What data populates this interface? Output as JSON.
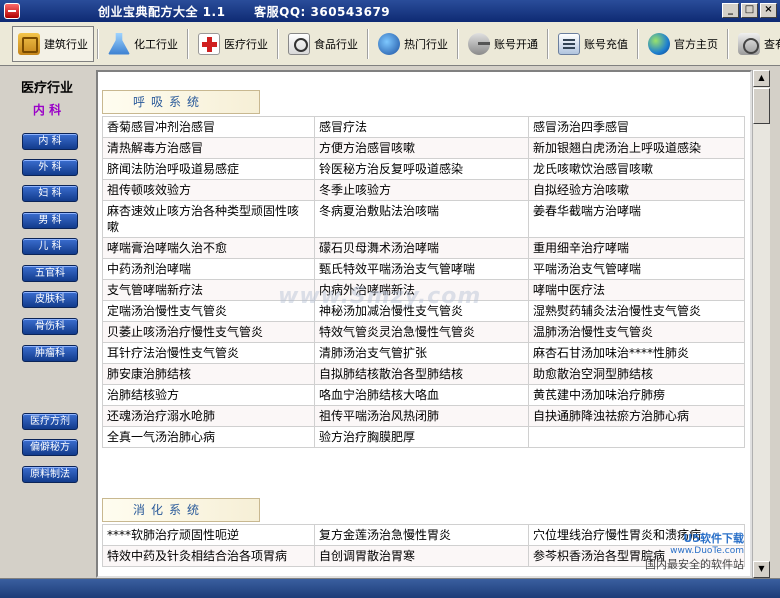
{
  "window": {
    "title": "创业宝典配方大全 1.1",
    "service": "客服QQ: 360543679",
    "controls": [
      "_",
      "□",
      "×"
    ]
  },
  "toolbar": [
    {
      "label": "建筑行业",
      "icon": "building-icon"
    },
    {
      "label": "化工行业",
      "icon": "flask-icon"
    },
    {
      "label": "医疗行业",
      "icon": "medical-cross-icon"
    },
    {
      "label": "食品行业",
      "icon": "food-icon"
    },
    {
      "label": "热门行业",
      "icon": "globe-icon"
    },
    {
      "label": "账号开通",
      "icon": "key-icon"
    },
    {
      "label": "账号充值",
      "icon": "card-icon"
    },
    {
      "label": "官方主页",
      "icon": "home-globe-icon"
    },
    {
      "label": "查有效期",
      "icon": "clock-icon"
    }
  ],
  "sidebar": {
    "title": "医疗行业",
    "subtitle": "内 科",
    "items": [
      "内 科",
      "外 科",
      "妇 科",
      "男 科",
      "儿 科",
      "五官科",
      "皮肤科",
      "骨伤科",
      "肿瘤科"
    ],
    "extra": [
      "医疗方剂",
      "偏僻秘方",
      "原料制法"
    ]
  },
  "sections": [
    {
      "title": "呼吸系统",
      "rows": [
        [
          "香菊感冒冲剂治感冒",
          "感冒疗法",
          "感冒汤治四季感冒"
        ],
        [
          "清热解毒方治感冒",
          "方便方治感冒咳嗽",
          "新加银翘白虎汤治上呼吸道感染"
        ],
        [
          "脐闻法防治呼吸道易感症",
          "铃医秘方治反复呼吸道感染",
          "龙氏咳嗽饮治感冒咳嗽"
        ],
        [
          "祖传顿咳效验方",
          "冬季止咳验方",
          "自拟经验方治咳嗽"
        ],
        [
          "麻杏速效止咳方治各种类型顽固性咳嗽",
          "冬病夏治敷贴法治咳喘",
          "姜春华截喘方治哮喘"
        ],
        [
          "哮喘膏治哮喘久治不愈",
          "礞石贝母㵲术汤治哮喘",
          "重用细辛治疗哮喘"
        ],
        [
          "中药汤剂治哮喘",
          "甄氏特效平喘汤治支气管哮喘",
          "平喘汤治支气管哮喘"
        ],
        [
          "支气管哮喘新疗法",
          "内病外治哮喘新法",
          "哮喘中医疗法"
        ],
        [
          "定喘汤治慢性支气管炎",
          "神秘汤加减治慢性支气管炎",
          "湿熟熨药辅灸法治慢性支气管炎"
        ],
        [
          "贝萎止咳汤治疗慢性支气管炎",
          "特效气管炎灵治急慢性气管炎",
          "温肺汤治慢性支气管炎"
        ],
        [
          "耳针疗法治慢性支气管炎",
          "清肺汤治支气管扩张",
          "麻杏石甘汤加味治****性肺炎"
        ],
        [
          "肺安康治肺结核",
          "自拟肺结核散治各型肺结核",
          "助愈散治空洞型肺结核"
        ],
        [
          "治肺结核验方",
          "咯血宁治肺结核大咯血",
          "黄芪建中汤加味治疗肺痨"
        ],
        [
          "还魂汤治疗溺水呛肺",
          "祖传平喘汤治风热闭肺",
          "自抉通肺降浊祛瘀方治肺心病"
        ],
        [
          "全真一气汤治肺心病",
          "验方治疗胸膜肥厚",
          ""
        ]
      ]
    },
    {
      "title": "消化系统",
      "rows": [
        [
          "****软肺治疗顽固性呃逆",
          "复方金莲汤治急慢性胃炎",
          "穴位埋线治疗慢性胃炎和溃疡病"
        ],
        [
          "特效中药及针灸相结合治各项胃病",
          "自创调胃散治胃寒",
          "参芩枳香汤治各型胃脘病"
        ]
      ]
    }
  ],
  "watermark": "www.Smzy.com",
  "brand": {
    "top": "U5软件下载",
    "url": "www.DuoTe.com",
    "cn": "国内最安全的软件站"
  }
}
